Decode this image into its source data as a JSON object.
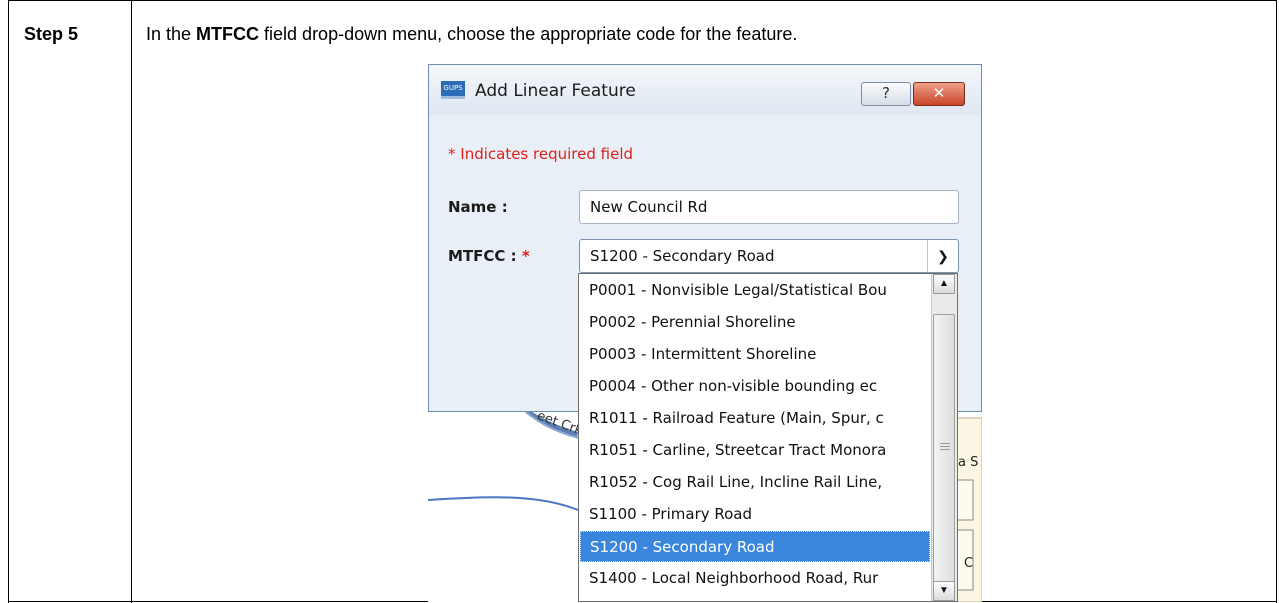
{
  "step": {
    "label": "Step 5",
    "instruction_pre": "In the ",
    "instruction_bold": "MTFCC",
    "instruction_post": " field drop-down menu, choose the appropriate code for the feature."
  },
  "dialog": {
    "icon_text": "GUPS",
    "title": "Add Linear Feature",
    "help_button": "?",
    "close_button": "✕",
    "required_note": "* Indicates required field",
    "name_label": "Name :",
    "name_value": "New Council Rd",
    "mtfcc_label": "MTFCC :",
    "mtfcc_required_mark": "*",
    "mtfcc_selected": "S1200 - Secondary Road"
  },
  "dropdown": {
    "options": [
      "P0001 - Nonvisible Legal/Statistical Bou",
      "P0002 - Perennial Shoreline",
      "P0003 - Intermittent Shoreline",
      "P0004 - Other non-visible bounding ec",
      "R1011 - Railroad Feature (Main, Spur, c",
      "R1051 - Carline, Streetcar Tract Monora",
      "R1052 - Cog Rail Line, Incline Rail Line,",
      "S1100 - Primary Road",
      "S1200 - Secondary Road",
      "S1400 - Local Neighborhood Road, Rur"
    ],
    "selected_index": 8
  },
  "map": {
    "label_fragment": "eet Crk",
    "right_fragment_1": "a S",
    "right_fragment_2": "C"
  },
  "colors": {
    "selection": "#3a86dc",
    "required": "#e0201a",
    "dialog_bg": "#e9eff6"
  }
}
